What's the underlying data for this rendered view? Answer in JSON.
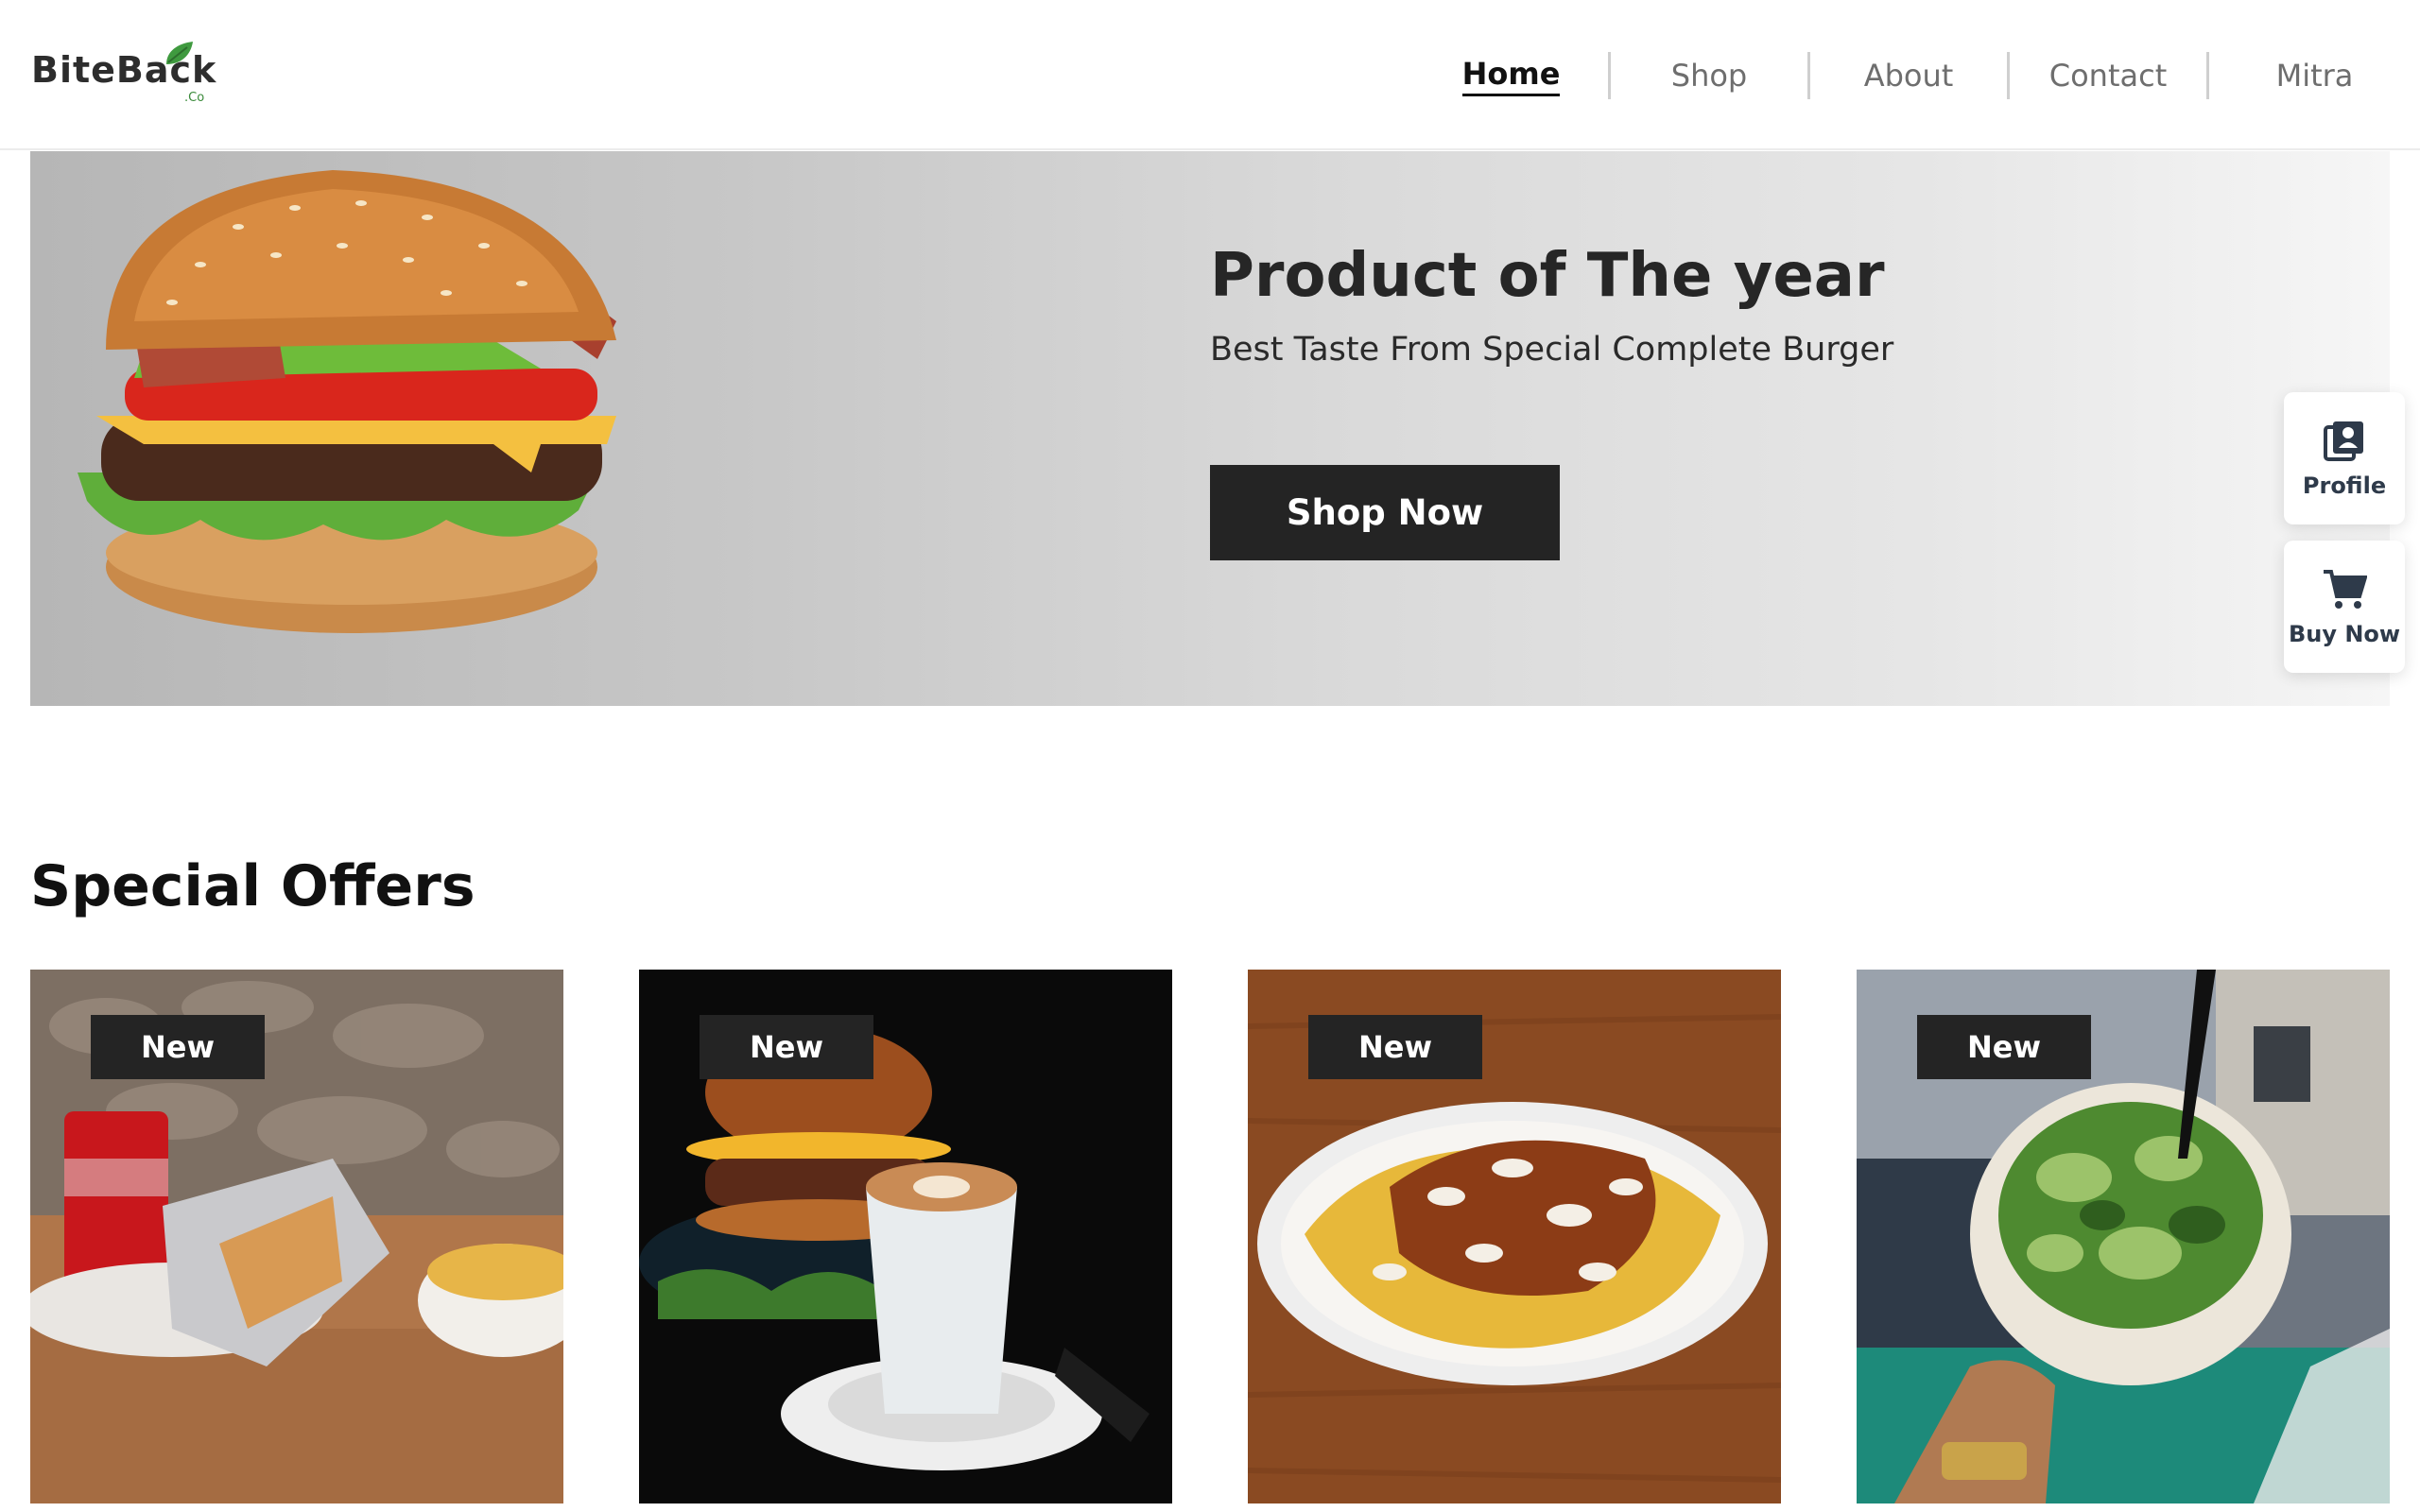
{
  "brand": {
    "name": "BiteBack",
    "suffix": ".Co"
  },
  "nav": {
    "items": [
      {
        "label": "Home",
        "active": true
      },
      {
        "label": "Shop",
        "active": false
      },
      {
        "label": "About",
        "active": false
      },
      {
        "label": "Contact",
        "active": false
      },
      {
        "label": "Mitra",
        "active": false
      }
    ]
  },
  "hero": {
    "title": "Product of The year",
    "subtitle": "Best Taste From Special Complete Burger",
    "cta_label": "Shop Now"
  },
  "side_actions": {
    "profile_label": "Profile",
    "buy_label": "Buy Now"
  },
  "offers": {
    "title": "Special Offers",
    "cards": [
      {
        "badge": "New",
        "image": "wrap-and-fries-with-cola"
      },
      {
        "badge": "New",
        "image": "burger-and-latte"
      },
      {
        "badge": "New",
        "image": "loaded-fries-plate"
      },
      {
        "badge": "New",
        "image": "salad-bowl-in-hand"
      }
    ]
  },
  "colors": {
    "dark": "#242424",
    "accent_green": "#3a8a3a",
    "nav_inactive": "#6e6e6e"
  }
}
